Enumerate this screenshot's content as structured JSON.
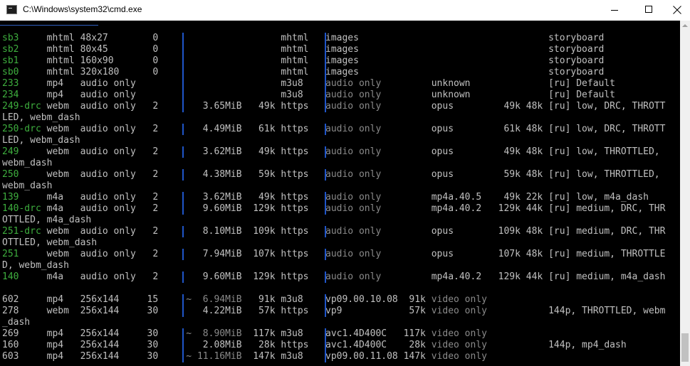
{
  "window": {
    "title": "C:\\Windows\\system32\\cmd.exe",
    "icon": "cmd-icon"
  },
  "colors": {
    "background": "#000000",
    "text": "#c0c0c0",
    "id_green": "#3eae3e",
    "dim_gray": "#8a8a8a",
    "separator_blue": "#1f55c8"
  },
  "rows": [
    {
      "id": "sb3",
      "ext": "mhtml",
      "res": "48x27",
      "fps": "0",
      "filesize": "",
      "tbr": "",
      "proto": "mhtml",
      "vcodec": "images",
      "vbr": "",
      "acodec": "",
      "abr": "",
      "asr": "",
      "more_info": "storyboard"
    },
    {
      "id": "sb2",
      "ext": "mhtml",
      "res": "80x45",
      "fps": "0",
      "filesize": "",
      "tbr": "",
      "proto": "mhtml",
      "vcodec": "images",
      "vbr": "",
      "acodec": "",
      "abr": "",
      "asr": "",
      "more_info": "storyboard"
    },
    {
      "id": "sb1",
      "ext": "mhtml",
      "res": "160x90",
      "fps": "0",
      "filesize": "",
      "tbr": "",
      "proto": "mhtml",
      "vcodec": "images",
      "vbr": "",
      "acodec": "",
      "abr": "",
      "asr": "",
      "more_info": "storyboard"
    },
    {
      "id": "sb0",
      "ext": "mhtml",
      "res": "320x180",
      "fps": "0",
      "filesize": "",
      "tbr": "",
      "proto": "mhtml",
      "vcodec": "images",
      "vbr": "",
      "acodec": "",
      "abr": "",
      "asr": "",
      "more_info": "storyboard"
    },
    {
      "id": "233",
      "ext": "mp4",
      "res": "audio only",
      "fps": "",
      "filesize": "",
      "tbr": "",
      "proto": "m3u8",
      "vcodec": "audio only",
      "vbr": "",
      "acodec": "unknown",
      "abr": "",
      "asr": "",
      "more_info": "[ru] Default"
    },
    {
      "id": "234",
      "ext": "mp4",
      "res": "audio only",
      "fps": "",
      "filesize": "",
      "tbr": "",
      "proto": "m3u8",
      "vcodec": "audio only",
      "vbr": "",
      "acodec": "unknown",
      "abr": "",
      "asr": "",
      "more_info": "[ru] Default"
    },
    {
      "id": "249-drc",
      "ext": "webm",
      "res": "audio only",
      "fps": "2",
      "filesize": "3.65MiB",
      "tbr": "49k",
      "proto": "https",
      "vcodec": "audio only",
      "vbr": "",
      "acodec": "opus",
      "abr": "49k",
      "asr": "48k",
      "more_info": "[ru] low, DRC, THROTT",
      "wrap": "LED, webm_dash"
    },
    {
      "id": "250-drc",
      "ext": "webm",
      "res": "audio only",
      "fps": "2",
      "filesize": "4.49MiB",
      "tbr": "61k",
      "proto": "https",
      "vcodec": "audio only",
      "vbr": "",
      "acodec": "opus",
      "abr": "61k",
      "asr": "48k",
      "more_info": "[ru] low, DRC, THROTT",
      "wrap": "LED, webm_dash"
    },
    {
      "id": "249",
      "ext": "webm",
      "res": "audio only",
      "fps": "2",
      "filesize": "3.62MiB",
      "tbr": "49k",
      "proto": "https",
      "vcodec": "audio only",
      "vbr": "",
      "acodec": "opus",
      "abr": "49k",
      "asr": "48k",
      "more_info": "[ru] low, THROTTLED,",
      "wrap": "webm_dash"
    },
    {
      "id": "250",
      "ext": "webm",
      "res": "audio only",
      "fps": "2",
      "filesize": "4.38MiB",
      "tbr": "59k",
      "proto": "https",
      "vcodec": "audio only",
      "vbr": "",
      "acodec": "opus",
      "abr": "59k",
      "asr": "48k",
      "more_info": "[ru] low, THROTTLED,",
      "wrap": "webm_dash"
    },
    {
      "id": "139",
      "ext": "m4a",
      "res": "audio only",
      "fps": "2",
      "filesize": "3.62MiB",
      "tbr": "49k",
      "proto": "https",
      "vcodec": "audio only",
      "vbr": "",
      "acodec": "mp4a.40.5",
      "abr": "49k",
      "asr": "22k",
      "more_info": "[ru] low, m4a_dash"
    },
    {
      "id": "140-drc",
      "ext": "m4a",
      "res": "audio only",
      "fps": "2",
      "filesize": "9.60MiB",
      "tbr": "129k",
      "proto": "https",
      "vcodec": "audio only",
      "vbr": "",
      "acodec": "mp4a.40.2",
      "abr": "129k",
      "asr": "44k",
      "more_info": "[ru] medium, DRC, THR",
      "wrap": "OTTLED, m4a_dash"
    },
    {
      "id": "251-drc",
      "ext": "webm",
      "res": "audio only",
      "fps": "2",
      "filesize": "8.10MiB",
      "tbr": "109k",
      "proto": "https",
      "vcodec": "audio only",
      "vbr": "",
      "acodec": "opus",
      "abr": "109k",
      "asr": "48k",
      "more_info": "[ru] medium, DRC, THR",
      "wrap": "OTTLED, webm_dash"
    },
    {
      "id": "251",
      "ext": "webm",
      "res": "audio only",
      "fps": "2",
      "filesize": "7.94MiB",
      "tbr": "107k",
      "proto": "https",
      "vcodec": "audio only",
      "vbr": "",
      "acodec": "opus",
      "abr": "107k",
      "asr": "48k",
      "more_info": "[ru] medium, THROTTLE",
      "wrap": "D, webm_dash"
    },
    {
      "id": "140",
      "ext": "m4a",
      "res": "audio only",
      "fps": "2",
      "filesize": "9.60MiB",
      "tbr": "129k",
      "proto": "https",
      "vcodec": "audio only",
      "vbr": "",
      "acodec": "mp4a.40.2",
      "abr": "129k",
      "asr": "44k",
      "more_info": "[ru] medium, m4a_dash"
    },
    {
      "blank": true
    },
    {
      "id": "602",
      "ext": "mp4",
      "res": "256x144",
      "fps": "15",
      "filesize": "~  6.94MiB",
      "tbr": "91k",
      "proto": "m3u8",
      "vcodec": "vp09.00.10.08",
      "vbr": "91k",
      "acodec": "video only",
      "abr": "",
      "asr": "",
      "more_info": ""
    },
    {
      "id": "278",
      "ext": "webm",
      "res": "256x144",
      "fps": "30",
      "filesize": "4.22MiB",
      "tbr": "57k",
      "proto": "https",
      "vcodec": "vp9",
      "vbr": "57k",
      "acodec": "video only",
      "abr": "",
      "asr": "",
      "more_info": "144p, THROTTLED, webm",
      "wrap": "_dash"
    },
    {
      "id": "269",
      "ext": "mp4",
      "res": "256x144",
      "fps": "30",
      "filesize": "~  8.90MiB",
      "tbr": "117k",
      "proto": "m3u8",
      "vcodec": "avc1.4D400C",
      "vbr": "117k",
      "acodec": "video only",
      "abr": "",
      "asr": "",
      "more_info": ""
    },
    {
      "id": "160",
      "ext": "mp4",
      "res": "256x144",
      "fps": "30",
      "filesize": "2.08MiB",
      "tbr": "28k",
      "proto": "https",
      "vcodec": "avc1.4D400C",
      "vbr": "28k",
      "acodec": "video only",
      "abr": "",
      "asr": "",
      "more_info": "144p, mp4_dash"
    },
    {
      "id": "603",
      "ext": "mp4",
      "res": "256x144",
      "fps": "30",
      "filesize": "~ 11.16MiB",
      "tbr": "147k",
      "proto": "m3u8",
      "vcodec": "vp09.00.11.08",
      "vbr": "147k",
      "acodec": "video only",
      "abr": "",
      "asr": "",
      "more_info": ""
    }
  ]
}
